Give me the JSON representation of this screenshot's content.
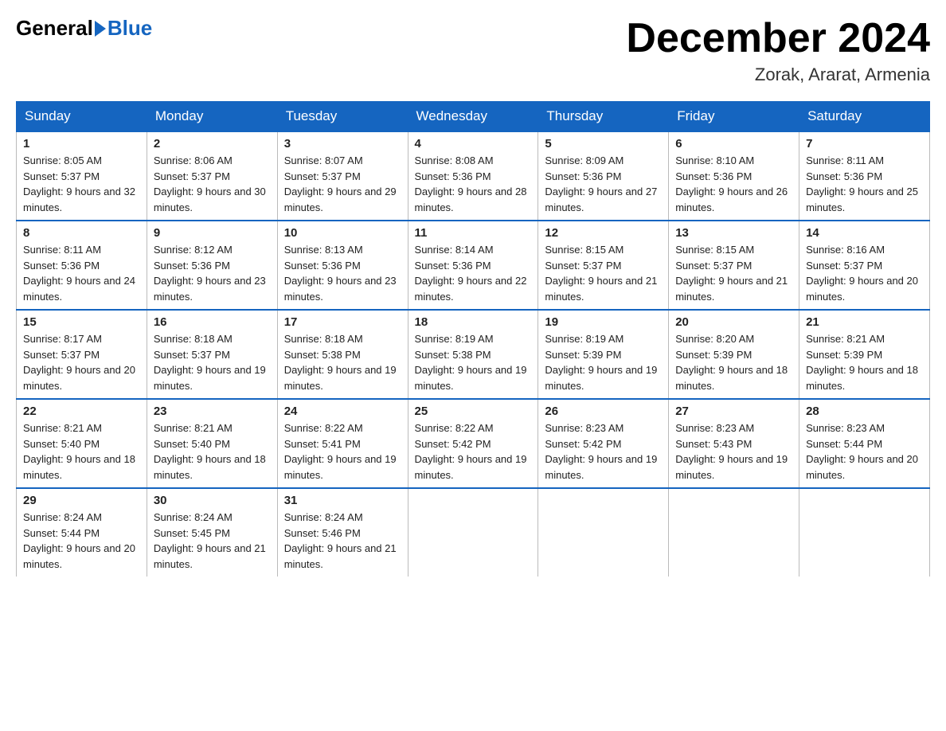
{
  "header": {
    "logo": {
      "text_general": "General",
      "text_blue": "Blue"
    },
    "title": "December 2024",
    "location": "Zorak, Ararat, Armenia"
  },
  "weekdays": [
    "Sunday",
    "Monday",
    "Tuesday",
    "Wednesday",
    "Thursday",
    "Friday",
    "Saturday"
  ],
  "weeks": [
    [
      {
        "day": "1",
        "sunrise": "8:05 AM",
        "sunset": "5:37 PM",
        "daylight": "9 hours and 32 minutes."
      },
      {
        "day": "2",
        "sunrise": "8:06 AM",
        "sunset": "5:37 PM",
        "daylight": "9 hours and 30 minutes."
      },
      {
        "day": "3",
        "sunrise": "8:07 AM",
        "sunset": "5:37 PM",
        "daylight": "9 hours and 29 minutes."
      },
      {
        "day": "4",
        "sunrise": "8:08 AM",
        "sunset": "5:36 PM",
        "daylight": "9 hours and 28 minutes."
      },
      {
        "day": "5",
        "sunrise": "8:09 AM",
        "sunset": "5:36 PM",
        "daylight": "9 hours and 27 minutes."
      },
      {
        "day": "6",
        "sunrise": "8:10 AM",
        "sunset": "5:36 PM",
        "daylight": "9 hours and 26 minutes."
      },
      {
        "day": "7",
        "sunrise": "8:11 AM",
        "sunset": "5:36 PM",
        "daylight": "9 hours and 25 minutes."
      }
    ],
    [
      {
        "day": "8",
        "sunrise": "8:11 AM",
        "sunset": "5:36 PM",
        "daylight": "9 hours and 24 minutes."
      },
      {
        "day": "9",
        "sunrise": "8:12 AM",
        "sunset": "5:36 PM",
        "daylight": "9 hours and 23 minutes."
      },
      {
        "day": "10",
        "sunrise": "8:13 AM",
        "sunset": "5:36 PM",
        "daylight": "9 hours and 23 minutes."
      },
      {
        "day": "11",
        "sunrise": "8:14 AM",
        "sunset": "5:36 PM",
        "daylight": "9 hours and 22 minutes."
      },
      {
        "day": "12",
        "sunrise": "8:15 AM",
        "sunset": "5:37 PM",
        "daylight": "9 hours and 21 minutes."
      },
      {
        "day": "13",
        "sunrise": "8:15 AM",
        "sunset": "5:37 PM",
        "daylight": "9 hours and 21 minutes."
      },
      {
        "day": "14",
        "sunrise": "8:16 AM",
        "sunset": "5:37 PM",
        "daylight": "9 hours and 20 minutes."
      }
    ],
    [
      {
        "day": "15",
        "sunrise": "8:17 AM",
        "sunset": "5:37 PM",
        "daylight": "9 hours and 20 minutes."
      },
      {
        "day": "16",
        "sunrise": "8:18 AM",
        "sunset": "5:37 PM",
        "daylight": "9 hours and 19 minutes."
      },
      {
        "day": "17",
        "sunrise": "8:18 AM",
        "sunset": "5:38 PM",
        "daylight": "9 hours and 19 minutes."
      },
      {
        "day": "18",
        "sunrise": "8:19 AM",
        "sunset": "5:38 PM",
        "daylight": "9 hours and 19 minutes."
      },
      {
        "day": "19",
        "sunrise": "8:19 AM",
        "sunset": "5:39 PM",
        "daylight": "9 hours and 19 minutes."
      },
      {
        "day": "20",
        "sunrise": "8:20 AM",
        "sunset": "5:39 PM",
        "daylight": "9 hours and 18 minutes."
      },
      {
        "day": "21",
        "sunrise": "8:21 AM",
        "sunset": "5:39 PM",
        "daylight": "9 hours and 18 minutes."
      }
    ],
    [
      {
        "day": "22",
        "sunrise": "8:21 AM",
        "sunset": "5:40 PM",
        "daylight": "9 hours and 18 minutes."
      },
      {
        "day": "23",
        "sunrise": "8:21 AM",
        "sunset": "5:40 PM",
        "daylight": "9 hours and 18 minutes."
      },
      {
        "day": "24",
        "sunrise": "8:22 AM",
        "sunset": "5:41 PM",
        "daylight": "9 hours and 19 minutes."
      },
      {
        "day": "25",
        "sunrise": "8:22 AM",
        "sunset": "5:42 PM",
        "daylight": "9 hours and 19 minutes."
      },
      {
        "day": "26",
        "sunrise": "8:23 AM",
        "sunset": "5:42 PM",
        "daylight": "9 hours and 19 minutes."
      },
      {
        "day": "27",
        "sunrise": "8:23 AM",
        "sunset": "5:43 PM",
        "daylight": "9 hours and 19 minutes."
      },
      {
        "day": "28",
        "sunrise": "8:23 AM",
        "sunset": "5:44 PM",
        "daylight": "9 hours and 20 minutes."
      }
    ],
    [
      {
        "day": "29",
        "sunrise": "8:24 AM",
        "sunset": "5:44 PM",
        "daylight": "9 hours and 20 minutes."
      },
      {
        "day": "30",
        "sunrise": "8:24 AM",
        "sunset": "5:45 PM",
        "daylight": "9 hours and 21 minutes."
      },
      {
        "day": "31",
        "sunrise": "8:24 AM",
        "sunset": "5:46 PM",
        "daylight": "9 hours and 21 minutes."
      },
      null,
      null,
      null,
      null
    ]
  ]
}
